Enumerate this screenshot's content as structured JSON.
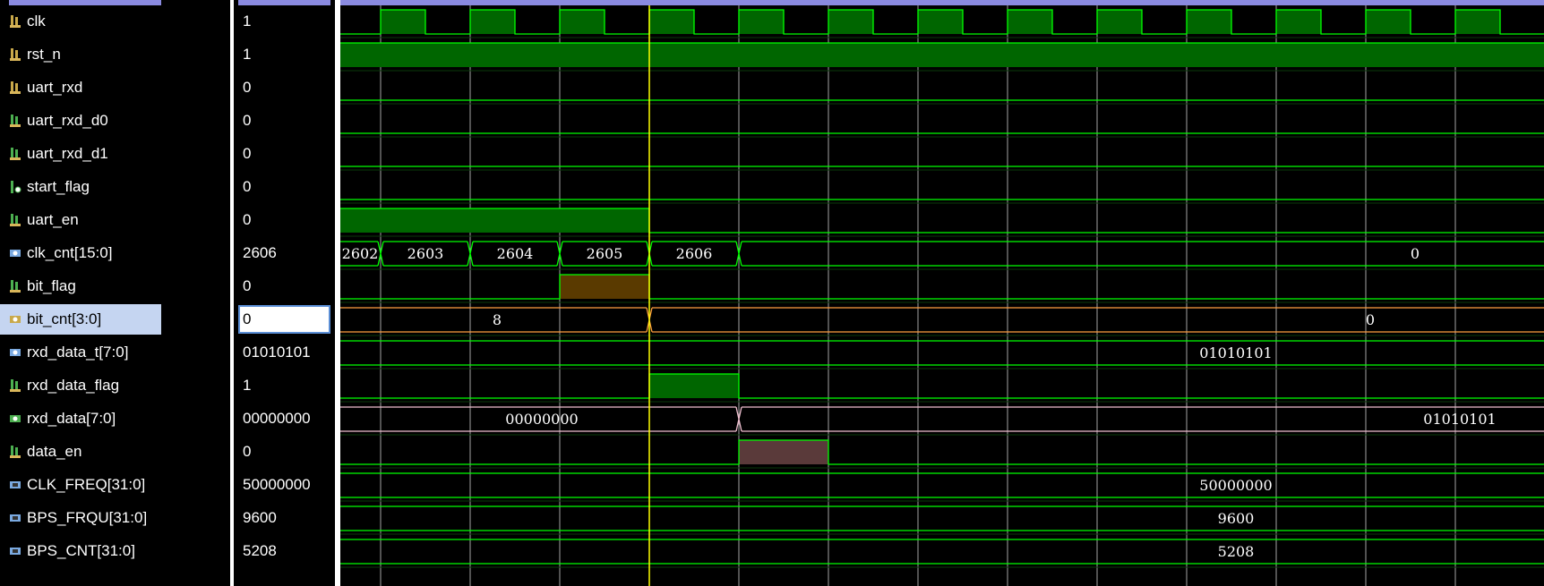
{
  "signals": [
    {
      "name": "clk",
      "value": "1",
      "icon": "bit-input-icon",
      "icon_color": "#c9a94a"
    },
    {
      "name": "rst_n",
      "value": "1",
      "icon": "bit-input-icon",
      "icon_color": "#c9a94a"
    },
    {
      "name": "uart_rxd",
      "value": "0",
      "icon": "bit-input-icon",
      "icon_color": "#c9a94a"
    },
    {
      "name": "uart_rxd_d0",
      "value": "0",
      "icon": "bit-reg-icon",
      "icon_color": "#4caf50"
    },
    {
      "name": "uart_rxd_d1",
      "value": "0",
      "icon": "bit-reg-icon",
      "icon_color": "#4caf50"
    },
    {
      "name": "start_flag",
      "value": "0",
      "icon": "bit-wire-icon",
      "icon_color": "#4caf50"
    },
    {
      "name": "uart_en",
      "value": "0",
      "icon": "bit-reg-icon",
      "icon_color": "#4caf50"
    },
    {
      "name": "clk_cnt[15:0]",
      "value": "2606",
      "icon": "bus-reg-icon",
      "icon_color": "#7aa9e0"
    },
    {
      "name": "bit_flag",
      "value": "0",
      "icon": "bit-reg-icon",
      "icon_color": "#4caf50"
    },
    {
      "name": "bit_cnt[3:0]",
      "value": "0",
      "icon": "bus-reg-icon",
      "icon_color": "#c9a94a",
      "selected": true
    },
    {
      "name": "rxd_data_t[7:0]",
      "value": "01010101",
      "icon": "bus-reg-icon",
      "icon_color": "#7aa9e0"
    },
    {
      "name": "rxd_data_flag",
      "value": "1",
      "icon": "bit-reg-icon",
      "icon_color": "#4caf50"
    },
    {
      "name": "rxd_data[7:0]",
      "value": "00000000",
      "icon": "bus-output-icon",
      "icon_color": "#4caf50"
    },
    {
      "name": "data_en",
      "value": "0",
      "icon": "bit-output-icon",
      "icon_color": "#4caf50"
    },
    {
      "name": "CLK_FREQ[31:0]",
      "value": "50000000",
      "icon": "param-icon",
      "icon_color": "#7aa9e0"
    },
    {
      "name": "BPS_FRQU[31:0]",
      "value": "9600",
      "icon": "param-icon",
      "icon_color": "#7aa9e0"
    },
    {
      "name": "BPS_CNT[31:0]",
      "value": "5208",
      "icon": "param-icon",
      "icon_color": "#7aa9e0"
    }
  ],
  "bus_labels": {
    "clk_cnt": [
      "2602",
      "2603",
      "2604",
      "2605",
      "2606",
      "0"
    ],
    "bit_cnt": [
      "8",
      "0"
    ],
    "rxd_data_t": [
      "01010101"
    ],
    "rxd_data": [
      "00000000",
      "01010101"
    ],
    "clk_freq": [
      "50000000"
    ],
    "bps_frqu": [
      "9600"
    ],
    "bps_cnt": [
      "5208"
    ]
  },
  "colors": {
    "wave_green": "#00ff00",
    "fill_green": "#006600",
    "cursor": "#ffff00",
    "selected_bus": "#ffa040",
    "bitflag_fill": "#5a3a00",
    "dataen_fill": "#5a3a3a",
    "grid": "#ffffff"
  }
}
